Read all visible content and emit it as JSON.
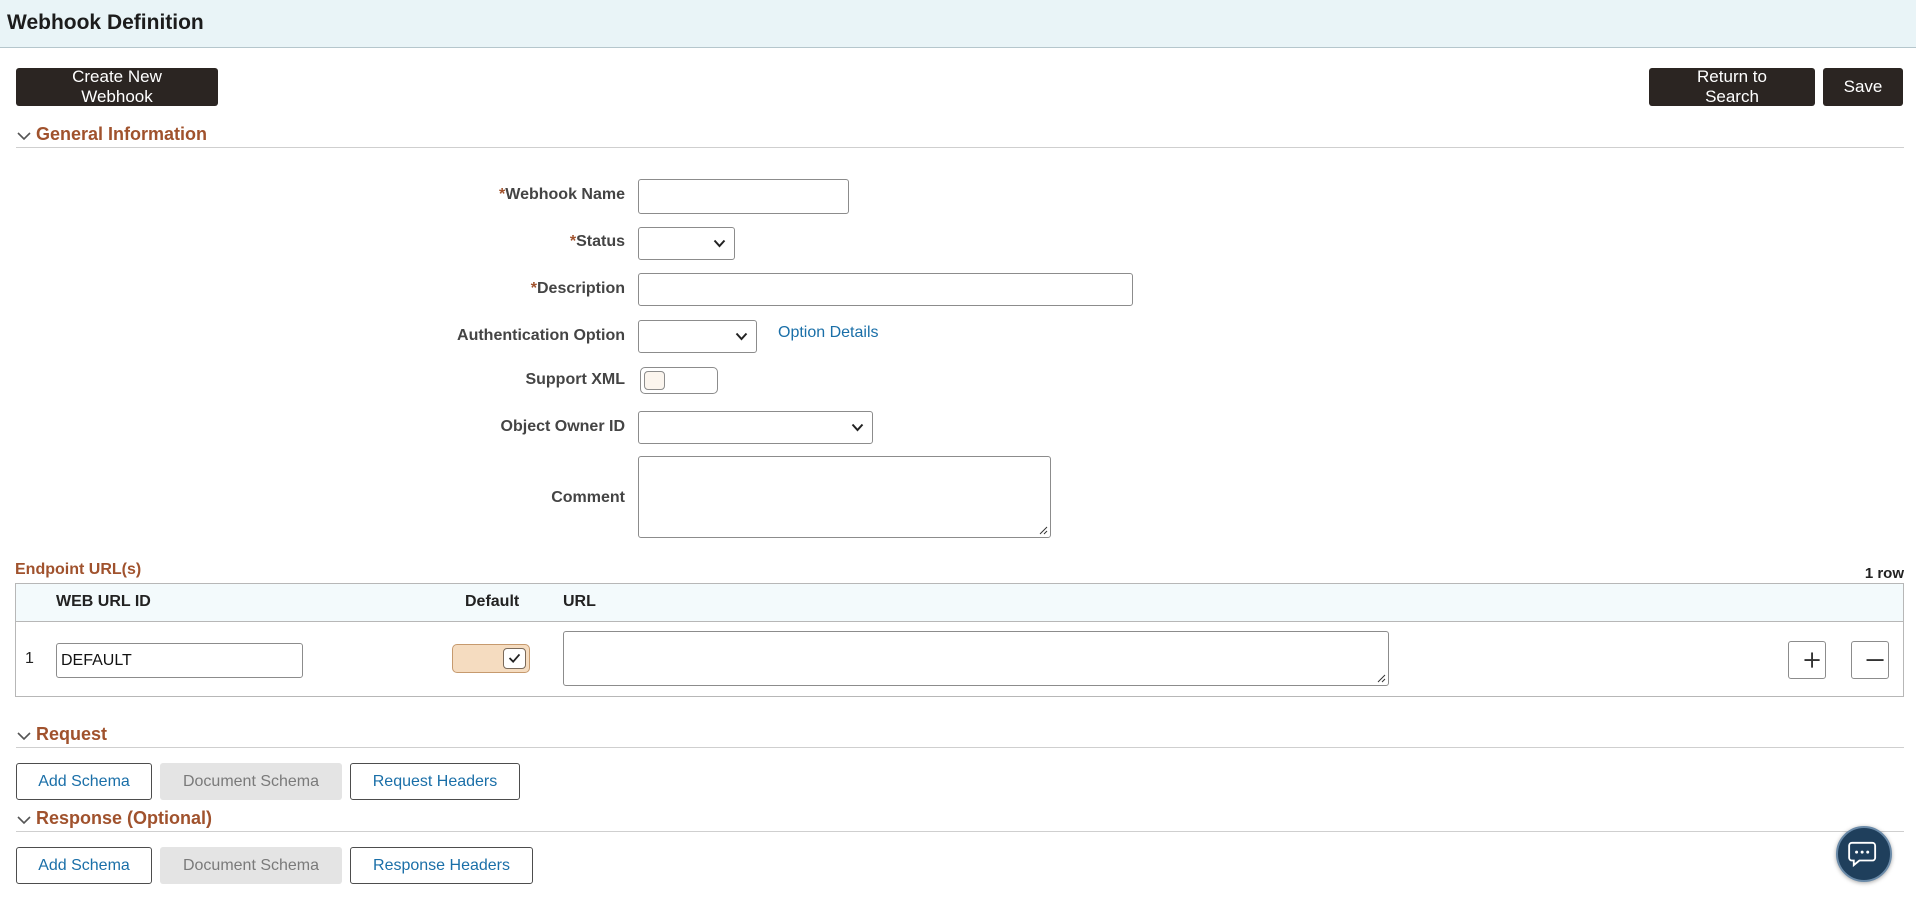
{
  "header": {
    "title": "Webhook Definition"
  },
  "toolbar": {
    "create_label": "Create New Webhook",
    "return_label": "Return to Search",
    "save_label": "Save"
  },
  "general": {
    "title": "General Information",
    "fields": {
      "webhook_name": {
        "required": "*",
        "label": "Webhook Name",
        "value": ""
      },
      "status": {
        "required": "*",
        "label": "Status",
        "value": ""
      },
      "description": {
        "required": "*",
        "label": "Description",
        "value": ""
      },
      "auth_option": {
        "label": "Authentication Option",
        "value": ""
      },
      "option_details": "Option Details",
      "support_xml": {
        "label": "Support XML",
        "value": false
      },
      "object_owner": {
        "label": "Object Owner ID",
        "value": ""
      },
      "comment": {
        "label": "Comment",
        "value": ""
      }
    }
  },
  "endpoints": {
    "title": "Endpoint URL(s)",
    "row_count": "1 row",
    "columns": {
      "web_url_id": "WEB URL ID",
      "default": "Default",
      "url": "URL"
    },
    "rows": [
      {
        "num": "1",
        "web_url_id": "DEFAULT",
        "default": true,
        "url": ""
      }
    ]
  },
  "request": {
    "title": "Request",
    "add_schema": "Add Schema",
    "document_schema": "Document Schema",
    "headers": "Request Headers"
  },
  "response": {
    "title": "Response (Optional)",
    "add_schema": "Add Schema",
    "document_schema": "Document Schema",
    "headers": "Response Headers"
  },
  "colors": {
    "accent": "#a0522d",
    "link": "#1a6fa8",
    "dark_button": "#2b2522",
    "header_bg": "#e9f4f7"
  }
}
